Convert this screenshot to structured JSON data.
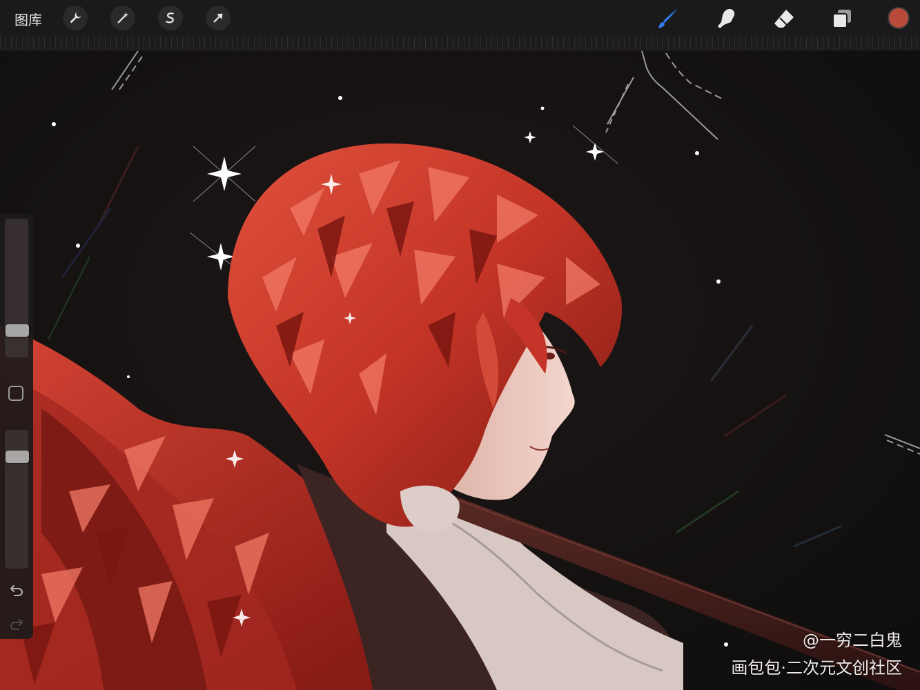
{
  "toolbar": {
    "gallery_label": "图库",
    "left_tools": [
      {
        "name": "actions",
        "icon": "wrench-icon"
      },
      {
        "name": "adjustments",
        "icon": "magic-wand-icon"
      },
      {
        "name": "selection",
        "icon": "selection-s-icon"
      },
      {
        "name": "transform",
        "icon": "arrow-cursor-icon"
      }
    ],
    "right_tools": [
      {
        "name": "brush",
        "icon": "brush-icon",
        "active": true
      },
      {
        "name": "smudge",
        "icon": "smudge-finger-icon"
      },
      {
        "name": "eraser",
        "icon": "eraser-icon"
      },
      {
        "name": "layers",
        "icon": "layers-icon"
      }
    ],
    "current_color": "#b84a3c",
    "active_tool_color": "#2f7df0"
  },
  "sidebar": {
    "brush_size_level": 0.17,
    "opacity_level": 0.84,
    "modify_icon": "square-icon",
    "undo_icon": "undo-arrow-icon",
    "redo_icon": "redo-arrow-icon"
  },
  "watermark": {
    "author": "@一穷二白鬼",
    "site": "画包包·二次元文创社区"
  },
  "colors": {
    "hair": "#c83a2c",
    "hair_light": "#f08070",
    "skin": "#e9c6bc",
    "background": "#120f0f",
    "staff": "#3a1c18"
  }
}
